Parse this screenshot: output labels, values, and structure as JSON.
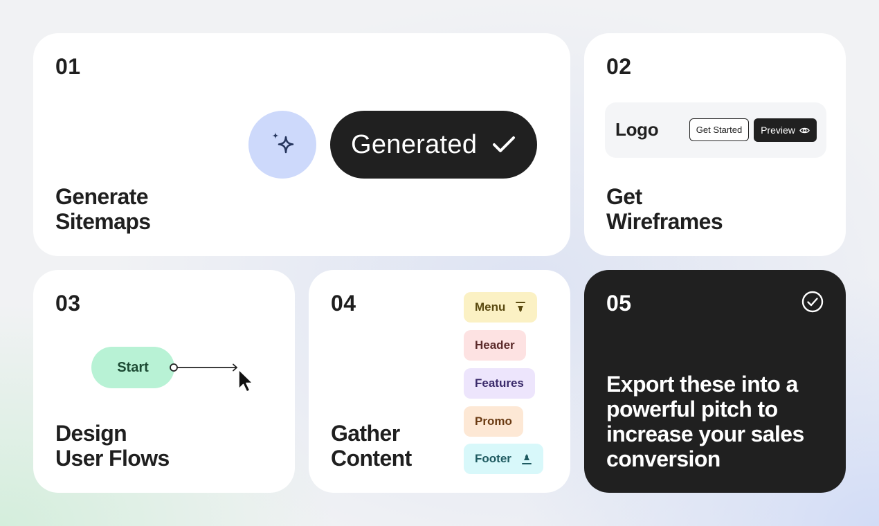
{
  "cards": {
    "sitemaps": {
      "number": "01",
      "title_line1": "Generate",
      "title_line2": "Sitemaps",
      "generated_label": "Generated",
      "accent_color": "#cdd9fb"
    },
    "wireframes": {
      "number": "02",
      "title_line1": "Get",
      "title_line2": "Wireframes",
      "logo_text": "Logo",
      "get_started_label": "Get Started",
      "preview_label": "Preview"
    },
    "user_flows": {
      "number": "03",
      "title_line1": "Design",
      "title_line2": "User Flows",
      "start_label": "Start",
      "start_color": "#b8f2d5"
    },
    "content": {
      "number": "04",
      "title_line1": "Gather",
      "title_line2": "Content",
      "tags": [
        {
          "label": "Menu",
          "icon": "arrow-down-to-line-icon",
          "bg": "#fbf1c4",
          "fg": "#5a4a10"
        },
        {
          "label": "Header",
          "icon": "",
          "bg": "#fde2e2",
          "fg": "#5b2a2a"
        },
        {
          "label": "Features",
          "icon": "",
          "bg": "#ede5fc",
          "fg": "#3a2a6a"
        },
        {
          "label": "Promo",
          "icon": "",
          "bg": "#fde8d5",
          "fg": "#6a3a12"
        },
        {
          "label": "Footer",
          "icon": "arrow-up-from-line-icon",
          "bg": "#d8f8fa",
          "fg": "#1e5a60"
        }
      ]
    },
    "export": {
      "number": "05",
      "text": "Export these into a powerful pitch to increase your sales conversion",
      "background": "#202020"
    }
  }
}
